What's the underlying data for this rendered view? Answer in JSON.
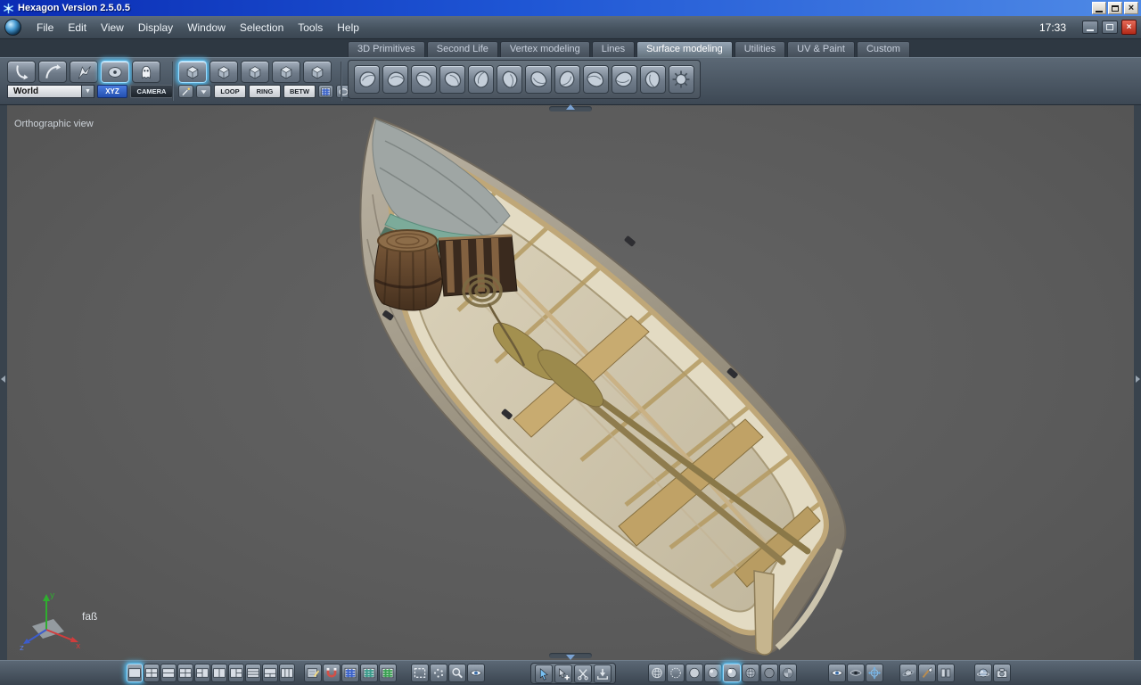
{
  "window": {
    "title": "Hexagon Version 2.5.0.5",
    "clock": "17:33"
  },
  "icons": {
    "close": "×",
    "dropdown_arrow": "▼"
  },
  "menubar": {
    "items": [
      {
        "label": "File"
      },
      {
        "label": "Edit"
      },
      {
        "label": "View"
      },
      {
        "label": "Display"
      },
      {
        "label": "Window"
      },
      {
        "label": "Selection"
      },
      {
        "label": "Tools"
      },
      {
        "label": "Help"
      }
    ]
  },
  "tabs": {
    "active": "Surface modeling",
    "items": [
      {
        "label": "3D Primitives"
      },
      {
        "label": "Second Life"
      },
      {
        "label": "Vertex modeling"
      },
      {
        "label": "Lines"
      },
      {
        "label": "Surface modeling"
      },
      {
        "label": "Utilities"
      },
      {
        "label": "UV & Paint"
      },
      {
        "label": "Custom"
      }
    ]
  },
  "toolbar": {
    "coordinate_space": {
      "selected": "World",
      "xyz_button": "XYZ",
      "camera_button": "CAMERA"
    },
    "selection_modifiers": {
      "loop": "LOOP",
      "ring": "RING",
      "betw": "BETW"
    }
  },
  "viewport": {
    "view_mode": "Orthographic view",
    "selected_object": "faß",
    "axis": {
      "x": "x",
      "y": "y",
      "z": "z"
    }
  },
  "colors": {
    "titlebar_blue": "#1e55d4",
    "selection_glow": "#54c8ff",
    "viewport_gray": "#5b5b5b",
    "axis_x_red": "#d23c3c",
    "axis_y_green": "#2fae2f",
    "axis_z_blue": "#3c5ccc"
  }
}
